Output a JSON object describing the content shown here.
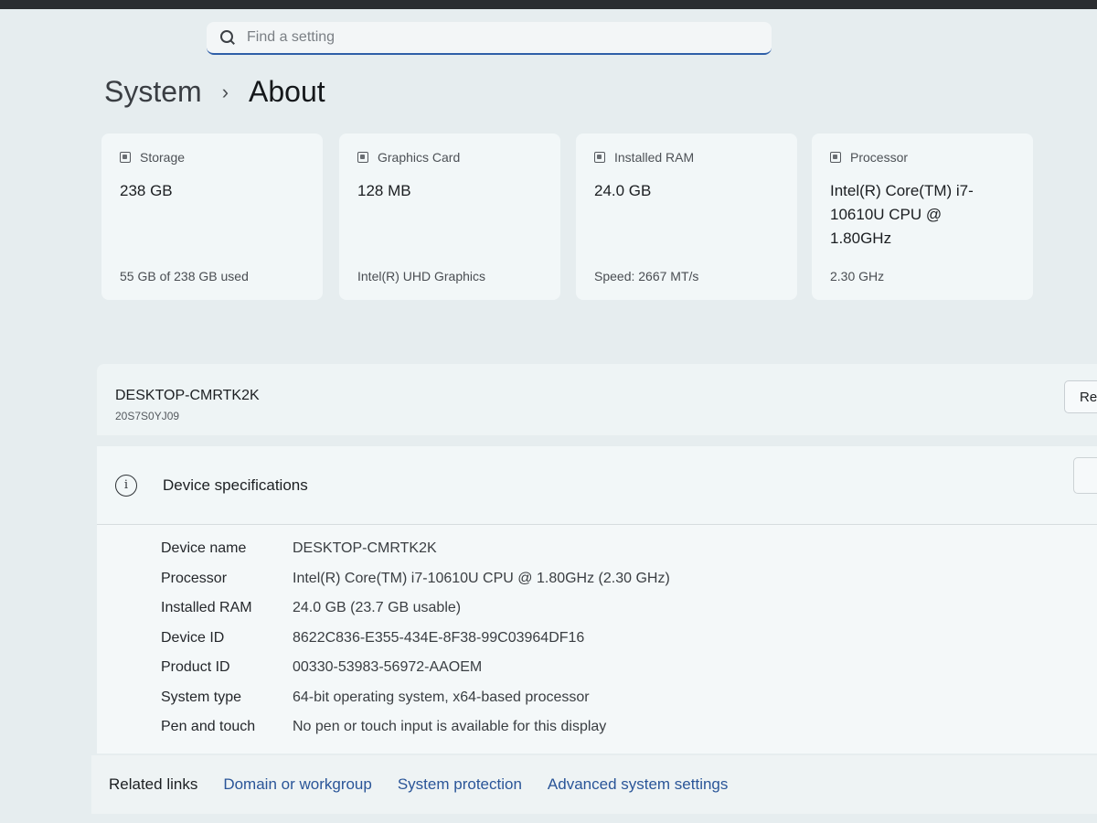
{
  "search": {
    "placeholder": "Find a setting"
  },
  "breadcrumb": {
    "parent": "System",
    "separator": "›",
    "current": "About"
  },
  "cards": [
    {
      "title": "Storage",
      "value": "238 GB",
      "sub": "55 GB of 238 GB used",
      "icon": "storage-icon"
    },
    {
      "title": "Graphics Card",
      "value": "128 MB",
      "sub": "Intel(R) UHD Graphics",
      "icon": "graphics-card-icon"
    },
    {
      "title": "Installed RAM",
      "value": "24.0 GB",
      "sub": "Speed: 2667 MT/s",
      "icon": "ram-icon"
    },
    {
      "title": "Processor",
      "value": "Intel(R) Core(TM) i7-10610U CPU @ 1.80GHz",
      "sub": "2.30 GHz",
      "icon": "processor-icon"
    }
  ],
  "device": {
    "name": "DESKTOP-CMRTK2K",
    "model": "20S7S0YJ09",
    "rename_label": "Rename this PC"
  },
  "specs": {
    "title": "Device specifications",
    "rows": [
      {
        "label": "Device name",
        "value": "DESKTOP-CMRTK2K"
      },
      {
        "label": "Processor",
        "value": "Intel(R) Core(TM) i7-10610U CPU @ 1.80GHz (2.30 GHz)"
      },
      {
        "label": "Installed RAM",
        "value": "24.0 GB (23.7 GB usable)"
      },
      {
        "label": "Device ID",
        "value": "8622C836-E355-434E-8F38-99C03964DF16"
      },
      {
        "label": "Product ID",
        "value": "00330-53983-56972-AAOEM"
      },
      {
        "label": "System type",
        "value": "64-bit operating system, x64-based processor"
      },
      {
        "label": "Pen and touch",
        "value": "No pen or touch input is available for this display"
      }
    ]
  },
  "related": {
    "title": "Related links",
    "links": [
      "Domain or workgroup",
      "System protection",
      "Advanced system settings"
    ]
  },
  "colors": {
    "link": "#2a5598",
    "accent": "#2f5fa8",
    "background": "#e6edef"
  }
}
